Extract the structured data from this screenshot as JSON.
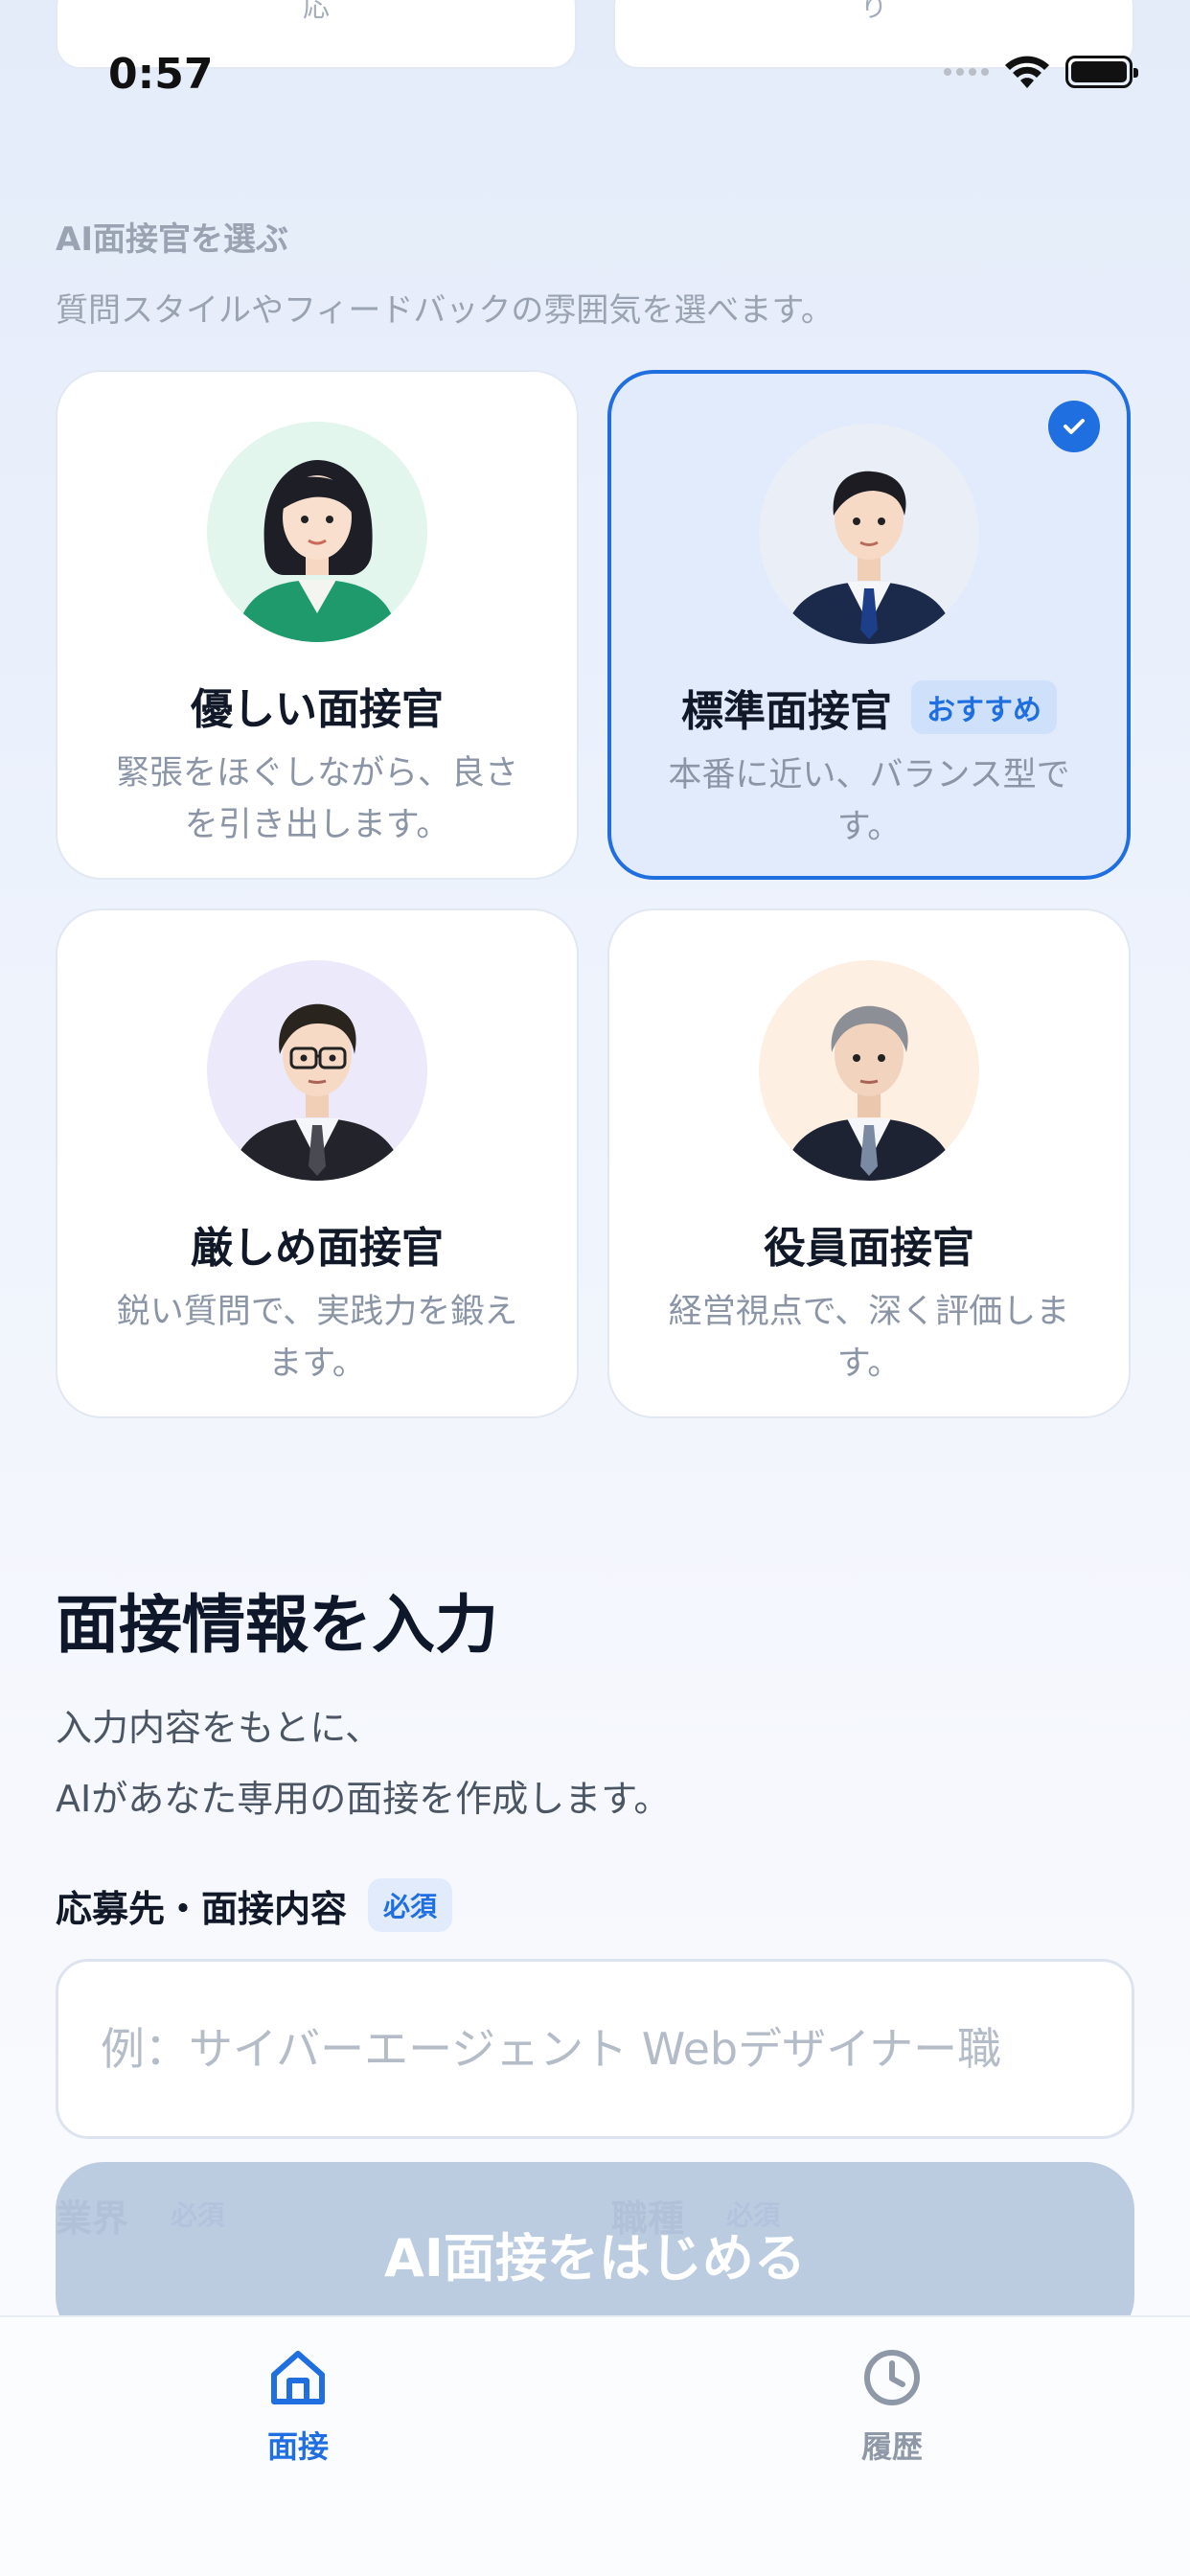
{
  "status_bar": {
    "time": "0:57"
  },
  "top_cards": [
    {
      "text": "応"
    },
    {
      "text": "り"
    }
  ],
  "interviewer_section": {
    "label": "AI面接官を選ぶ",
    "subtitle": "質問スタイルやフィードバックの雰囲気を選べます。"
  },
  "interviewers": [
    {
      "name": "優しい面接官",
      "description": "緊張をほぐしながら、良さを引き出します。",
      "selected": false,
      "avatar_bg": "#e3f6ee",
      "avatar_icon": "friendly-woman-avatar"
    },
    {
      "name": "標準面接官",
      "badge": "おすすめ",
      "description": "本番に近い、バランス型です。",
      "selected": true,
      "avatar_bg": "#e9eef7",
      "avatar_icon": "standard-man-avatar"
    },
    {
      "name": "厳しめ面接官",
      "description": "鋭い質問で、実践力を鍛えます。",
      "selected": false,
      "avatar_bg": "#ece9fa",
      "avatar_icon": "strict-man-glasses-avatar"
    },
    {
      "name": "役員面接官",
      "description": "経営視点で、深く評価します。",
      "selected": false,
      "avatar_bg": "#fdf0e2",
      "avatar_icon": "executive-man-avatar"
    }
  ],
  "form": {
    "title": "面接情報を入力",
    "description_line1": "入力内容をもとに、",
    "description_line2": "AIがあなた専用の面接を作成します。",
    "field1_label": "応募先・面接内容",
    "required": "必須",
    "field1_placeholder": "例：サイバーエージェント Webデザイナー職",
    "field2_label": "業界",
    "field3_label": "職種"
  },
  "start_button": {
    "label": "AI面接をはじめる"
  },
  "tabbar": {
    "tabs": [
      {
        "label": "面接",
        "icon": "home-icon",
        "active": true
      },
      {
        "label": "履歴",
        "icon": "clock-icon",
        "active": false
      }
    ]
  },
  "colors": {
    "accent": "#1f6fe0",
    "muted": "#8b95a6"
  }
}
